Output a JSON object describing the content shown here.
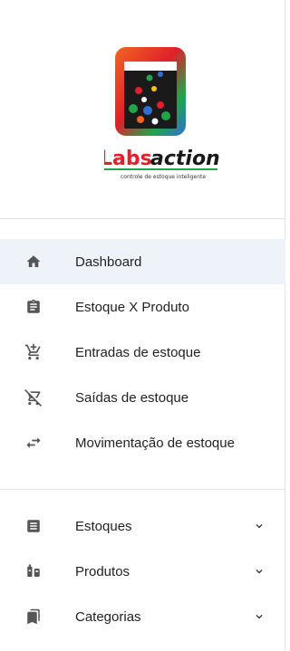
{
  "logo": {
    "brand_part1": "Labs",
    "brand_part2": "action",
    "tagline": "controle de estoque inteligente",
    "colors": {
      "orange": "#f26522",
      "green": "#1fa64a",
      "red": "#e0202b",
      "blue": "#2f6fd6",
      "dark": "#1a1a1a"
    }
  },
  "nav_main": [
    {
      "label": "Dashboard",
      "icon": "home-icon",
      "active": true
    },
    {
      "label": "Estoque X Produto",
      "icon": "clipboard-icon",
      "active": false
    },
    {
      "label": "Entradas de estoque",
      "icon": "cart-add-icon",
      "active": false
    },
    {
      "label": "Saídas de estoque",
      "icon": "cart-remove-icon",
      "active": false
    },
    {
      "label": "Movimentação de estoque",
      "icon": "swap-icon",
      "active": false
    }
  ],
  "nav_groups": [
    {
      "label": "Estoques",
      "icon": "document-icon"
    },
    {
      "label": "Produtos",
      "icon": "products-icon"
    },
    {
      "label": "Categorias",
      "icon": "bookmarks-icon"
    }
  ],
  "colors": {
    "active_bg": "#eef2f9",
    "icon": "#555555"
  }
}
